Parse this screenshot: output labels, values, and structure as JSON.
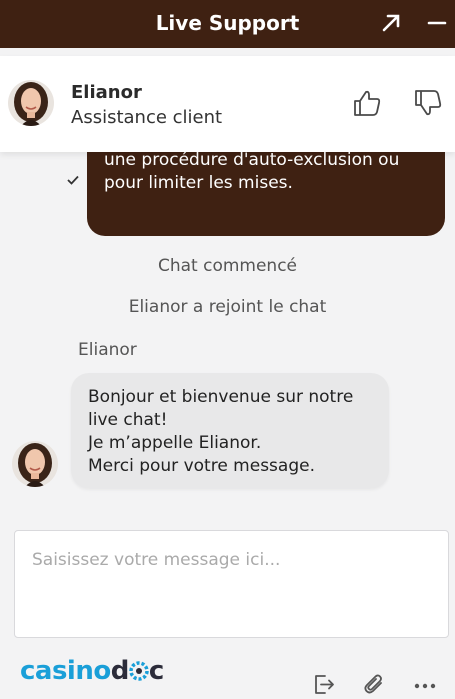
{
  "header": {
    "title": "Live Support"
  },
  "agent": {
    "name": "Elianor",
    "role": "Assistance client"
  },
  "messages": {
    "outgoing_text": "Je voulais savoir si vous proposez\nune procédure d'auto-exclusion ou\npour limiter les mises.",
    "system_chat_started": "Chat commencé",
    "system_agent_joined": "Elianor a rejoint le chat",
    "incoming_sender": "Elianor",
    "incoming_text": "Bonjour et bienvenue sur notre\nlive chat!\nJe m’appelle Elianor.\nMerci pour votre message."
  },
  "composer": {
    "placeholder": "Saisissez votre message ici..."
  },
  "footer": {
    "logo_part1": "casino",
    "logo_part2": "d",
    "logo_part3": "c"
  },
  "colors": {
    "brand": "#3f2112",
    "accent": "#1a9fd8"
  },
  "icons": [
    "expand-icon",
    "minimize-icon",
    "thumbs-up-icon",
    "thumbs-down-icon",
    "sent-check-icon",
    "exit-icon",
    "paperclip-icon",
    "more-icon"
  ]
}
